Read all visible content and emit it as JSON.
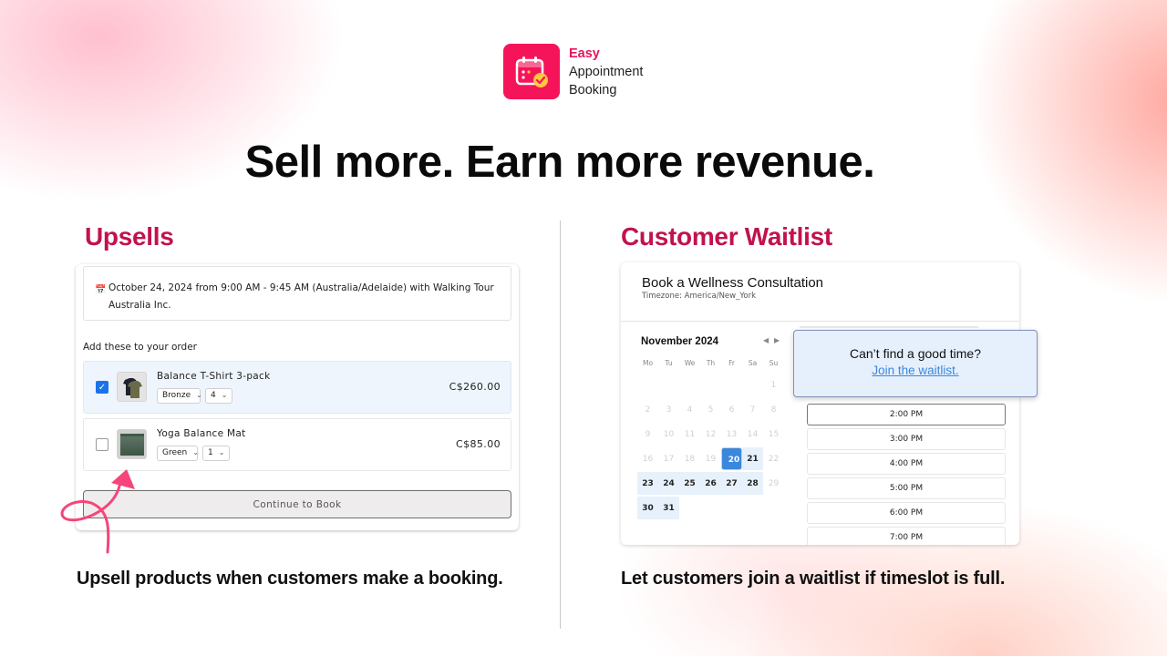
{
  "brand": {
    "name_line1": "Easy",
    "name_line2": "Appointment",
    "name_line3": "Booking",
    "accent_color": "#f5145a",
    "icon": "calendar-check-icon"
  },
  "headline": "Sell more. Earn more revenue.",
  "upsells": {
    "title": "Upsells",
    "booking_icon": "calendar-icon",
    "booking_summary_line1": "October 24, 2024 from 9:00 AM - 9:45 AM (Australia/Adelaide) with Walking Tour",
    "booking_summary_line2": "Australia Inc.",
    "add_label": "Add these to your order",
    "items": [
      {
        "name": "Balance T-Shirt 3-pack",
        "checked": true,
        "variant": "Bronze",
        "quantity": "4",
        "price": "C$260.00"
      },
      {
        "name": "Yoga Balance Mat",
        "checked": false,
        "variant": "Green",
        "quantity": "1",
        "price": "C$85.00"
      }
    ],
    "continue_label": "Continue to Book",
    "caption": "Upsell products when customers make a booking."
  },
  "waitlist": {
    "title": "Customer Waitlist",
    "form_title": "Book a Wellness Consultation",
    "timezone": "Timezone: America/New_York",
    "month": "November 2024",
    "weekdays": [
      "Mo",
      "Tu",
      "We",
      "Th",
      "Fr",
      "Sa",
      "Su"
    ],
    "selected_day": "20",
    "available_days": [
      "21",
      "23",
      "24",
      "25",
      "26",
      "27",
      "28",
      "30",
      "31"
    ],
    "popup_question": "Can’t find a good time?",
    "popup_link": "Join the waitlist.",
    "time_slots": [
      "2:00 PM",
      "3:00 PM",
      "4:00 PM",
      "5:00 PM",
      "6:00 PM",
      "7:00 PM"
    ],
    "caption": "Let customers join a waitlist if timeslot is full."
  }
}
